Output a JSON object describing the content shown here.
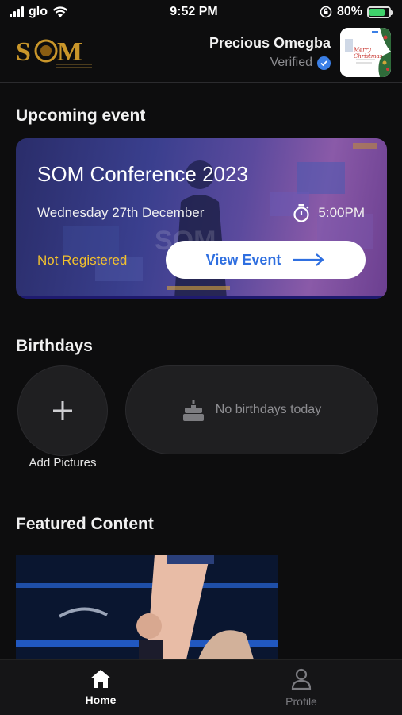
{
  "status_bar": {
    "carrier": "glo",
    "time": "9:52 PM",
    "battery": "80%",
    "battery_level": 0.8
  },
  "header": {
    "logo_text": "SOM",
    "user_name": "Precious Omegba",
    "verified_label": "Verified",
    "avatar_text": "Merry Christmas"
  },
  "upcoming": {
    "section_title": "Upcoming event",
    "event_title": "SOM Conference 2023",
    "event_date": "Wednesday 27th December",
    "event_time": "5:00PM",
    "status": "Not Registered",
    "view_button": "View Event"
  },
  "birthdays": {
    "section_title": "Birthdays",
    "add_label": "Add Pictures",
    "empty_message": "No birthdays today"
  },
  "featured": {
    "section_title": "Featured Content"
  },
  "tabs": [
    {
      "label": "Home",
      "icon": "home-icon",
      "active": true
    },
    {
      "label": "Profile",
      "icon": "profile-icon",
      "active": false
    }
  ],
  "colors": {
    "background": "#0d0d0e",
    "accent_blue": "#2f6fe0",
    "status_yellow": "#f2c12e",
    "verified_blue": "#3b7fe6",
    "logo_gold": "#c9962a"
  }
}
